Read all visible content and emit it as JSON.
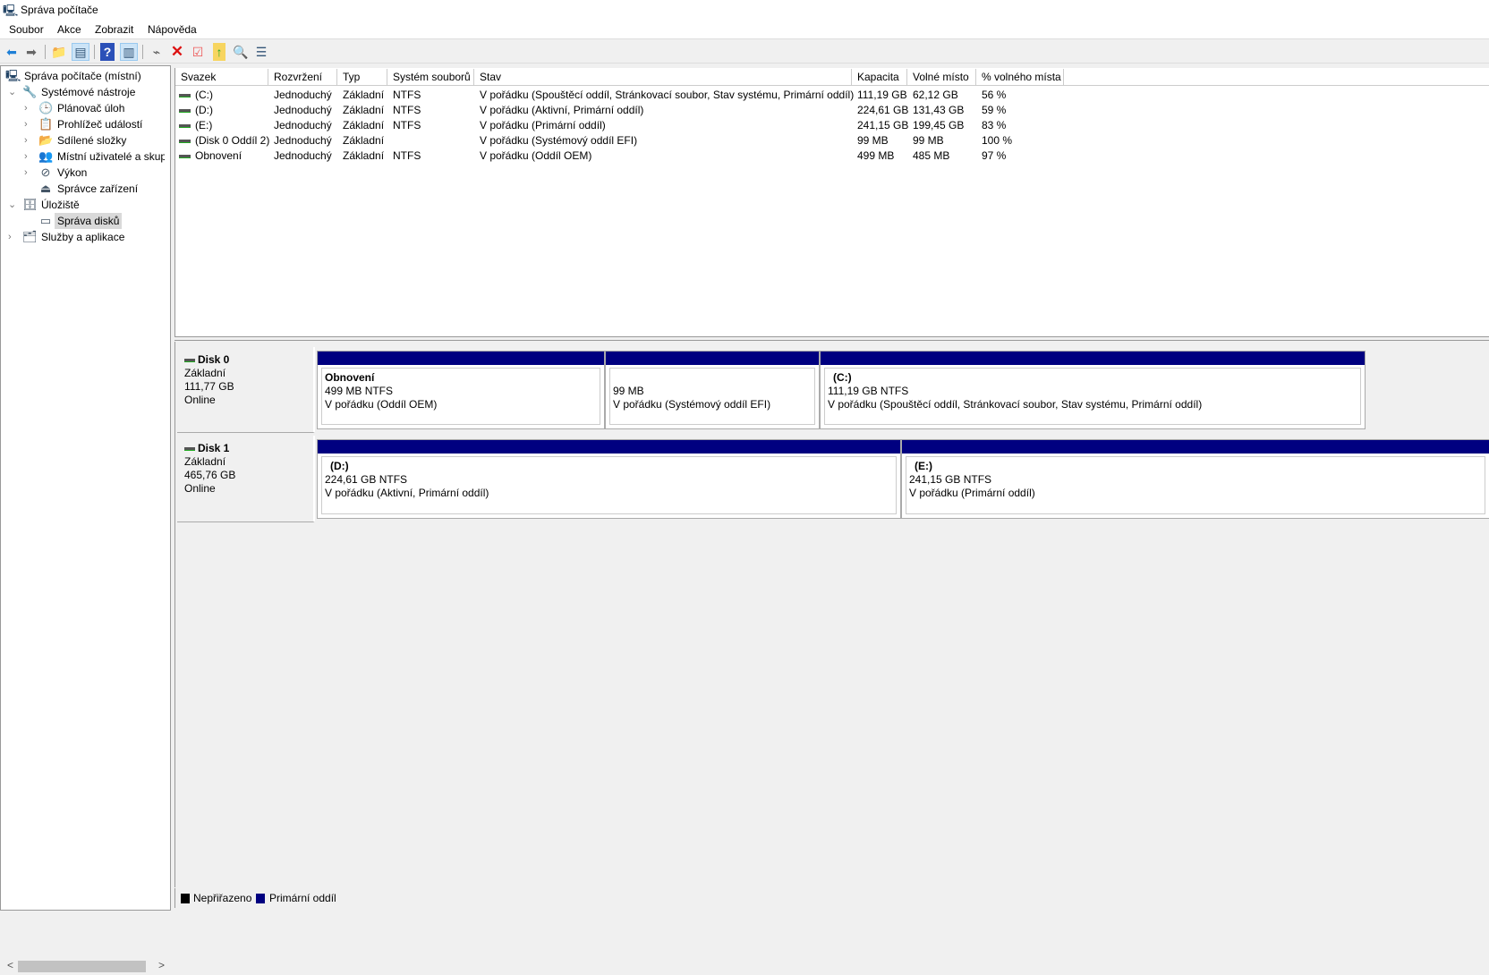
{
  "window": {
    "title": "Správa počítače"
  },
  "menu": [
    "Soubor",
    "Akce",
    "Zobrazit",
    "Nápověda"
  ],
  "toolbar": [
    "back-icon",
    "forward-icon",
    "up-folder-icon",
    "show-hide-tree-icon",
    "help-icon",
    "show-hide-action-pane-icon",
    "connect-drive-icon",
    "delete-icon",
    "properties-icon",
    "export-icon",
    "search-icon",
    "list-icon"
  ],
  "tree": {
    "root": "Správa počítače (místní)",
    "items": [
      {
        "label": "Systémové nástroje",
        "level": 1,
        "expanded": true
      },
      {
        "label": "Plánovač úloh",
        "level": 2
      },
      {
        "label": "Prohlížeč událostí",
        "level": 2
      },
      {
        "label": "Sdílené složky",
        "level": 2
      },
      {
        "label": "Místní uživatelé a skupiny",
        "level": 2
      },
      {
        "label": "Výkon",
        "level": 2
      },
      {
        "label": "Správce zařízení",
        "level": 2
      },
      {
        "label": "Úložiště",
        "level": 1,
        "expanded": true
      },
      {
        "label": "Správa disků",
        "level": 2,
        "selected": true
      },
      {
        "label": "Služby a aplikace",
        "level": 1
      }
    ]
  },
  "volumes": {
    "columns": [
      "Svazek",
      "Rozvržení",
      "Typ",
      "Systém souborů",
      "Stav",
      "Kapacita",
      "Volné místo",
      "% volného místa"
    ],
    "rows": [
      [
        "(C:)",
        "Jednoduchý",
        "Základní",
        "NTFS",
        "V pořádku (Spouštěcí oddíl, Stránkovací soubor, Stav systému, Primární oddíl)",
        "111,19 GB",
        "62,12 GB",
        "56 %"
      ],
      [
        "(D:)",
        "Jednoduchý",
        "Základní",
        "NTFS",
        "V pořádku (Aktivní, Primární oddíl)",
        "224,61 GB",
        "131,43 GB",
        "59 %"
      ],
      [
        "(E:)",
        "Jednoduchý",
        "Základní",
        "NTFS",
        "V pořádku (Primární oddíl)",
        "241,15 GB",
        "199,45 GB",
        "83 %"
      ],
      [
        "(Disk 0 Oddíl 2)",
        "Jednoduchý",
        "Základní",
        "",
        "V pořádku (Systémový oddíl EFI)",
        "99 MB",
        "99 MB",
        "100 %"
      ],
      [
        "Obnovení",
        "Jednoduchý",
        "Základní",
        "NTFS",
        "V pořádku (Oddíl OEM)",
        "499 MB",
        "485 MB",
        "97 %"
      ]
    ]
  },
  "disks": [
    {
      "name": "Disk 0",
      "type": "Základní",
      "size": "111,77 GB",
      "status": "Online",
      "partitions": [
        {
          "name": "Obnovení",
          "size": "499 MB NTFS",
          "status": "V pořádku (Oddíl OEM)"
        },
        {
          "name": "",
          "size": "99 MB",
          "status": "V pořádku (Systémový oddíl EFI)"
        },
        {
          "name": "(C:)",
          "size": "111,19 GB NTFS",
          "status": "V pořádku (Spouštěcí oddíl, Stránkovací soubor, Stav systému, Primární oddíl)"
        }
      ]
    },
    {
      "name": "Disk 1",
      "type": "Základní",
      "size": "465,76 GB",
      "status": "Online",
      "partitions": [
        {
          "name": "(D:)",
          "size": "224,61 GB NTFS",
          "status": "V pořádku (Aktivní, Primární oddíl)"
        },
        {
          "name": "(E:)",
          "size": "241,15 GB NTFS",
          "status": "V pořádku (Primární oddíl)"
        }
      ]
    }
  ],
  "legend": [
    {
      "label": "Nepřiřazeno",
      "color": "#000000"
    },
    {
      "label": "Primární oddíl",
      "color": "#000080"
    }
  ],
  "colors": {
    "primary_partition": "#000080",
    "unallocated": "#000000"
  }
}
